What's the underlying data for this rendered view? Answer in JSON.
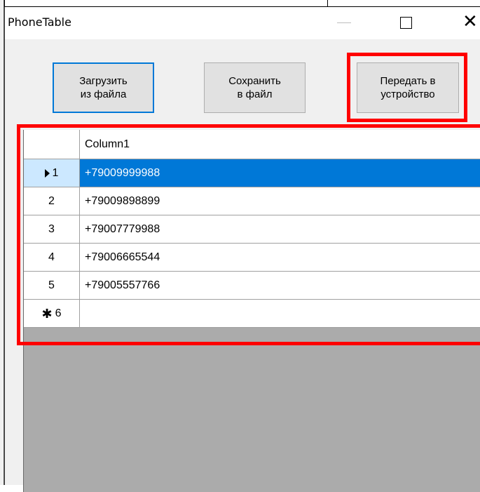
{
  "window": {
    "title": "PhoneTable"
  },
  "titlebar_controls": {
    "minimize_icon": "minimize-icon",
    "maximize_icon": "maximize-icon",
    "close_glyph": "✕"
  },
  "toolbar": {
    "load_label": "Загрузить\nиз файла",
    "save_label": "Сохранить\nв файл",
    "send_label": "Передать в\nустройство"
  },
  "grid": {
    "column_header": "Column1",
    "rows": [
      {
        "index": "1",
        "value": "+79009999988",
        "selected": true
      },
      {
        "index": "2",
        "value": "+79009898899"
      },
      {
        "index": "3",
        "value": "+79007779988"
      },
      {
        "index": "4",
        "value": "+79006665544"
      },
      {
        "index": "5",
        "value": "+79005557766"
      }
    ],
    "new_row": {
      "index": "6",
      "marker": "✱",
      "value": ""
    }
  },
  "colors": {
    "highlight": "#ff0000",
    "selection": "#0078d7",
    "grid_background": "#ababab"
  }
}
